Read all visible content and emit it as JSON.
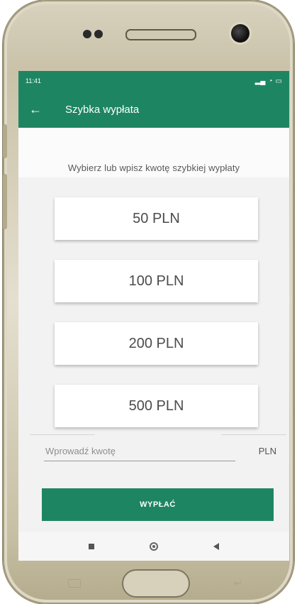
{
  "status_bar": {
    "time": "11:41",
    "icons": [
      "signal-icon",
      "wifi-icon",
      "battery-icon"
    ]
  },
  "app_bar": {
    "title": "Szybka wypłata",
    "back_icon": "arrow-left-icon"
  },
  "subtitle": "Wybierz lub wpisz kwotę szybkiej wypłaty",
  "amounts": [
    {
      "label": "50 PLN"
    },
    {
      "label": "100 PLN"
    },
    {
      "label": "200 PLN"
    },
    {
      "label": "500 PLN"
    }
  ],
  "amount_input": {
    "placeholder": "Wprowadź kwotę",
    "value": "",
    "currency": "PLN"
  },
  "withdraw_button": {
    "label": "WYPŁAĆ"
  },
  "colors": {
    "accent": "#1e8563",
    "screen_bg": "#f2f2f2",
    "device_frame": "#d8d2bf"
  }
}
